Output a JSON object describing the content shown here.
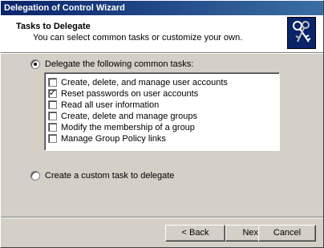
{
  "window": {
    "title": "Delegation of Control Wizard"
  },
  "header": {
    "title": "Tasks to Delegate",
    "subtitle": "You can select common tasks or customize your own.",
    "icon": "keys-icon"
  },
  "options": {
    "common": {
      "label": "Delegate the following common tasks:",
      "selected": true
    },
    "custom": {
      "label": "Create a custom task to delegate",
      "selected": false
    }
  },
  "tasks": [
    {
      "label": "Create, delete, and manage user accounts",
      "checked": false
    },
    {
      "label": "Reset passwords on user accounts",
      "checked": true
    },
    {
      "label": "Read all user information",
      "checked": false
    },
    {
      "label": "Create, delete and manage groups",
      "checked": false
    },
    {
      "label": "Modify the membership of a group",
      "checked": false
    },
    {
      "label": "Manage Group Policy links",
      "checked": false
    }
  ],
  "buttons": {
    "back": "< Back",
    "next": "Next >",
    "cancel": "Cancel"
  }
}
